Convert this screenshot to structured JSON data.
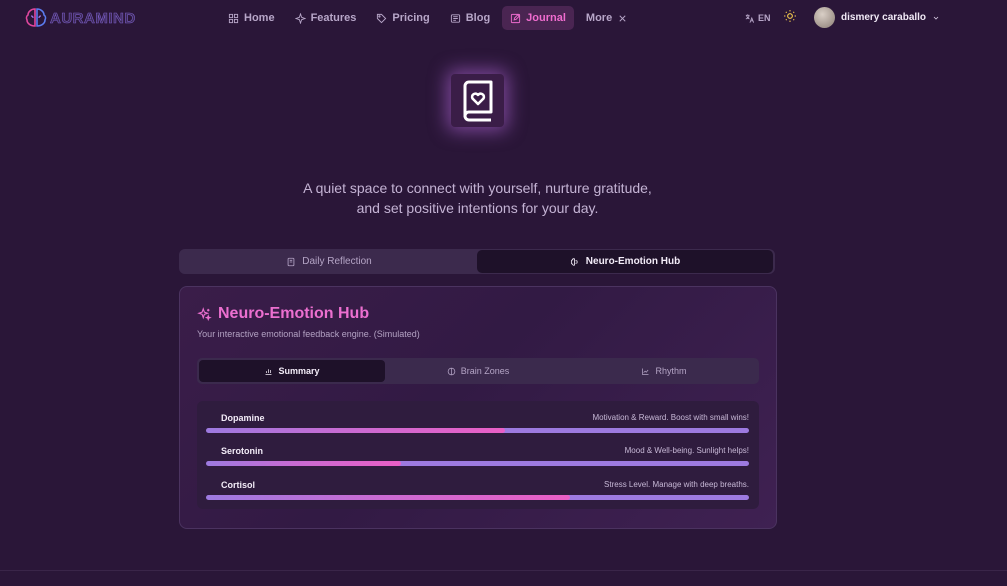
{
  "header": {
    "logo_text": "AURAMIND",
    "nav": [
      {
        "label": "Home",
        "icon": "grid-icon"
      },
      {
        "label": "Features",
        "icon": "sparkle-icon"
      },
      {
        "label": "Pricing",
        "icon": "tag-icon"
      },
      {
        "label": "Blog",
        "icon": "newspaper-icon"
      },
      {
        "label": "Journal",
        "icon": "edit-icon",
        "active": true
      },
      {
        "label": "More",
        "icon": "close-icon"
      }
    ],
    "language": "EN",
    "user_name": "dismery caraballo"
  },
  "hero": {
    "tagline_line1": "A quiet space to connect with yourself, nurture gratitude,",
    "tagline_line2": "and set positive intentions for your day."
  },
  "main_tabs": [
    {
      "label": "Daily Reflection",
      "active": false
    },
    {
      "label": "Neuro-Emotion Hub",
      "active": true
    }
  ],
  "hub": {
    "title": "Neuro-Emotion Hub",
    "subtitle": "Your interactive emotional feedback engine. (Simulated)",
    "tabs": [
      {
        "label": "Summary",
        "active": true
      },
      {
        "label": "Brain Zones",
        "active": false
      },
      {
        "label": "Rhythm",
        "active": false
      }
    ],
    "levels": [
      {
        "name": "Dopamine",
        "description": "Motivation & Reward. Boost with small wins!",
        "value": 0.55
      },
      {
        "name": "Serotonin",
        "description": "Mood & Well-being. Sunlight helps!",
        "value": 0.36
      },
      {
        "name": "Cortisol",
        "description": "Stress Level. Manage with deep breaths.",
        "value": 0.67
      }
    ]
  },
  "colors": {
    "background": "#2a1638",
    "accent_pink": "#ec6fd0",
    "bar_purple": "#9d7ae0",
    "sun_yellow": "#f2c94c"
  }
}
